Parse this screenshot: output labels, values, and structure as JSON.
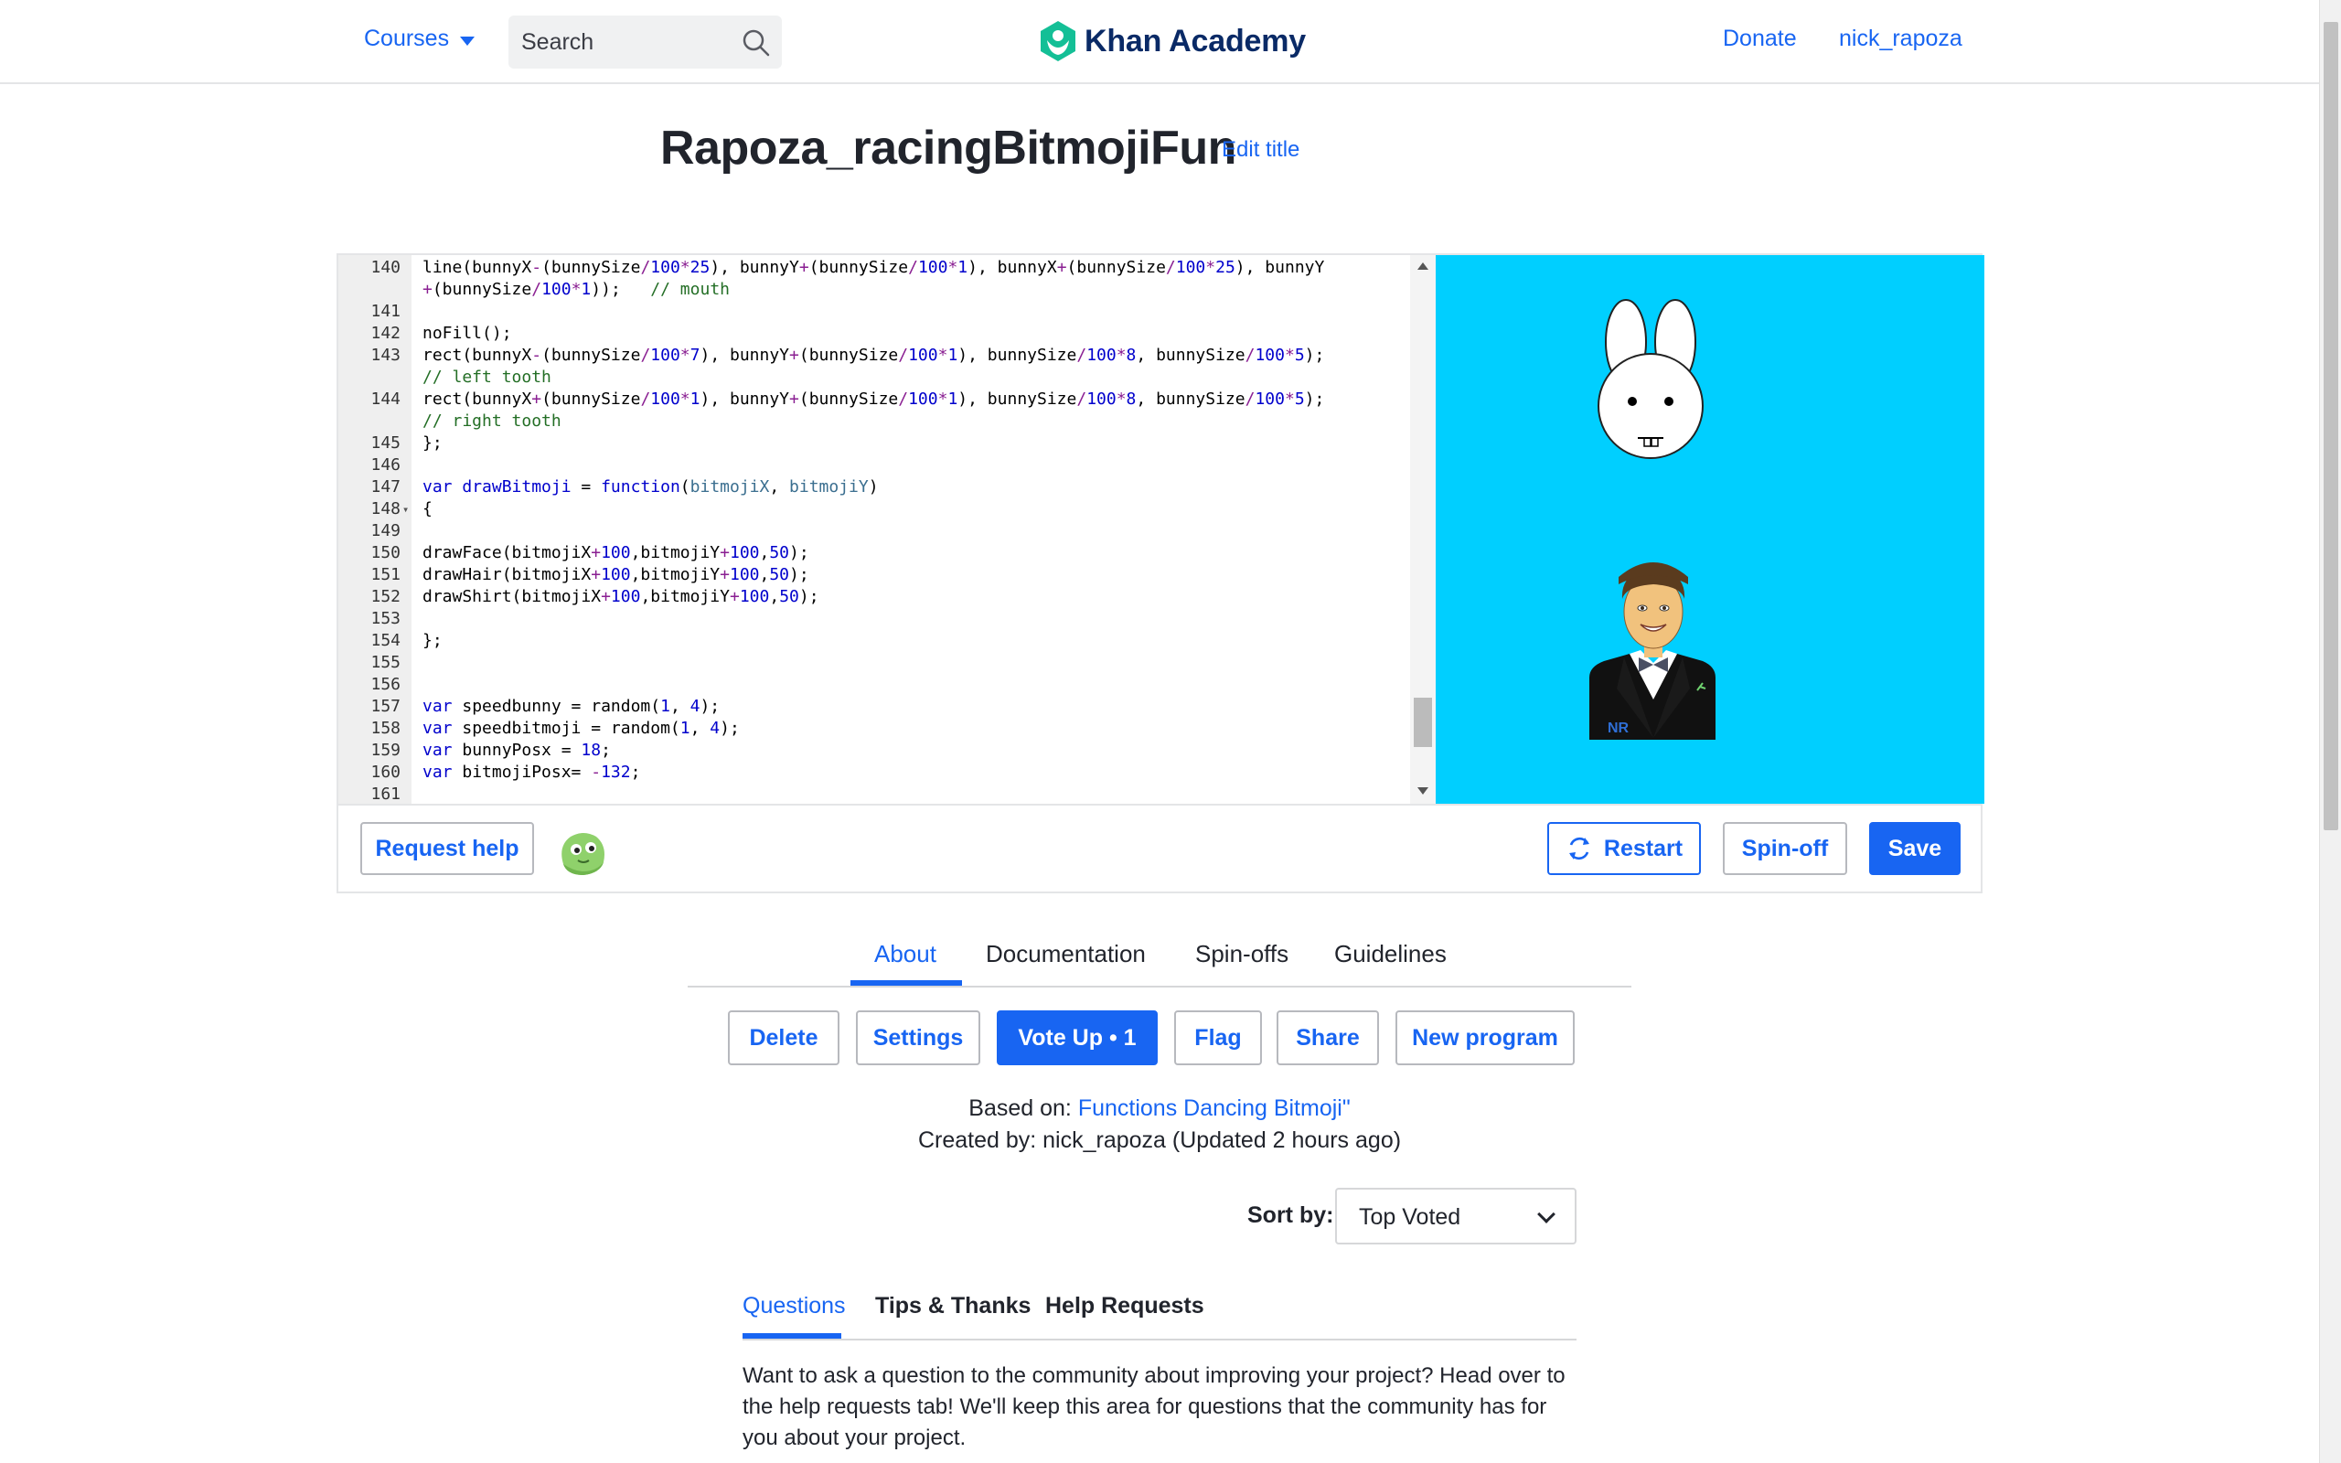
{
  "header": {
    "courses_label": "Courses",
    "search_placeholder": "Search",
    "logo_text": "Khan Academy",
    "donate_label": "Donate",
    "username": "nick_rapoza"
  },
  "program": {
    "title": "Rapoza_racingBitmojiFun",
    "edit_title_label": "Edit title"
  },
  "editor": {
    "line_numbers": [
      "140",
      "",
      "141",
      "142",
      "143",
      "",
      "144",
      "",
      "145",
      "146",
      "147",
      "148",
      "149",
      "150",
      "151",
      "152",
      "153",
      "154",
      "155",
      "156",
      "157",
      "158",
      "159",
      "160",
      "161"
    ]
  },
  "toolbar": {
    "request_help_label": "Request help",
    "restart_label": "Restart",
    "spinoff_label": "Spin-off",
    "save_label": "Save"
  },
  "tabs": [
    "About",
    "Documentation",
    "Spin-offs",
    "Guidelines"
  ],
  "about_buttons": {
    "delete": "Delete",
    "settings": "Settings",
    "vote_up": "Vote Up • 1",
    "flag": "Flag",
    "share": "Share",
    "new_program": "New program"
  },
  "meta": {
    "based_on_label": "Based on:",
    "based_on_link": "Functions Dancing Bitmoji\"",
    "created_by": "Created by: nick_rapoza (Updated 2 hours ago)"
  },
  "sort": {
    "label": "Sort by:",
    "selected": "Top Voted"
  },
  "question_tabs": [
    "Questions",
    "Tips & Thanks",
    "Help Requests"
  ],
  "questions_text": "Want to ask a question to the community about improving your project? Head over to the help requests tab! We'll keep this area for questions that the community has for you about your project.",
  "colors": {
    "accent": "#1865f2",
    "canvas_bg": "#00cfff",
    "logo_green": "#14bf96"
  }
}
